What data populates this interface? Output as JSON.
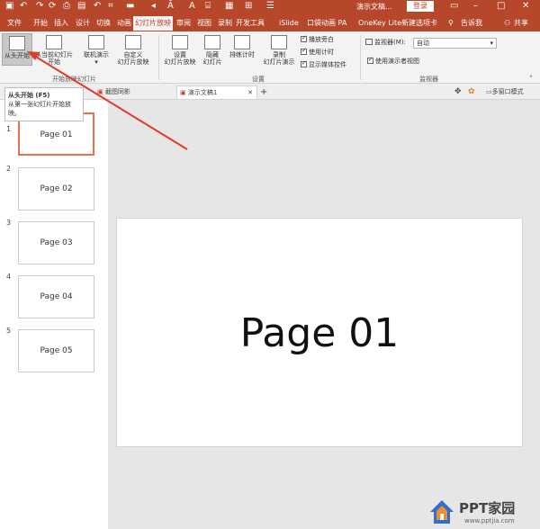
{
  "titlebar": {
    "doc_title": "演示文稿...",
    "login": "登录",
    "quick_icons": [
      "save-icon",
      "undo-icon",
      "redo-icon",
      "refresh-icon",
      "print-icon",
      "layout-icon",
      "undo2-icon",
      "crop-icon",
      "text-size-icon",
      "font-color-icon",
      "format-icon",
      "shape-icon",
      "grid-icon",
      "table-icon",
      "align-icon",
      "more-icon"
    ]
  },
  "tabs": [
    "文件",
    "开始",
    "插入",
    "设计",
    "切换",
    "动画",
    "幻灯片放映",
    "审阅",
    "视图",
    "录制",
    "开发工具",
    "iSlide",
    "口袋动画 PA",
    "OneKey Lite",
    "新建选项卡",
    "告诉我",
    "共享"
  ],
  "ribbon": {
    "from_start": "从头开始",
    "from_current_line1": "从当前幻灯片",
    "from_current_line2": "开始",
    "online": "联机演示",
    "custom_line1": "自定义",
    "custom_line2": "幻灯片放映",
    "group1_label": "开始放映幻灯片",
    "setup_line1": "设置",
    "setup_line2": "幻灯片放映",
    "hide_line1": "隐藏",
    "hide_line2": "幻灯片",
    "rehearse": "排练计时",
    "record_line1": "录制",
    "record_line2": "幻灯片演示",
    "chk_narration": "播放旁白",
    "chk_timing": "使用计时",
    "chk_media": "显示媒体控件",
    "group2_label": "设置",
    "monitor_label": "监视器(M):",
    "monitor_value": "自动",
    "presenter_view": "使用演示者视图",
    "group3_label": "监视器"
  },
  "tooltip": {
    "title": "从头开始 (F5)",
    "desc": "从第一张幻灯片开始放映。"
  },
  "doctabs": {
    "tab1": "截图同影",
    "tab2": "演示文稿1",
    "multiwindow": "多窗口模式"
  },
  "thumbnails": [
    {
      "num": "1",
      "label": "Page 01"
    },
    {
      "num": "2",
      "label": "Page 02"
    },
    {
      "num": "3",
      "label": "Page 03"
    },
    {
      "num": "4",
      "label": "Page 04"
    },
    {
      "num": "5",
      "label": "Page 05"
    }
  ],
  "slide": {
    "title": "Page 01"
  },
  "watermark": {
    "name": "PPT家园",
    "url": "www.pptjia.com"
  },
  "colors": {
    "accent": "#b7472a",
    "arrow": "#e03b2b",
    "selected_border": "#e8714c"
  }
}
